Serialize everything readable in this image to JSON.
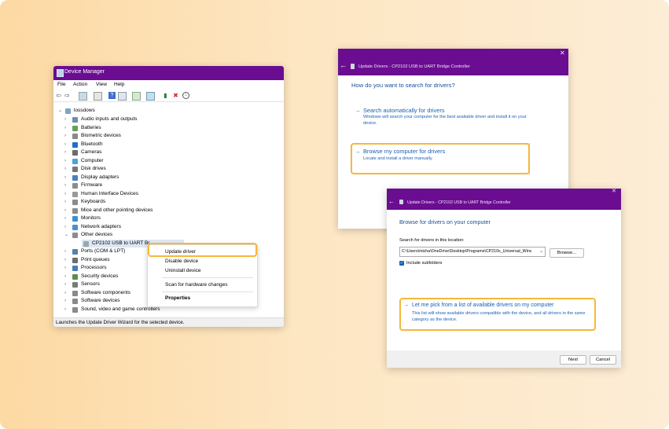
{
  "device_manager": {
    "title": "Device Manager",
    "menu": [
      "File",
      "Action",
      "View",
      "Help"
    ],
    "root": "lossdows",
    "categories": [
      "Audio inputs and outputs",
      "Batteries",
      "Biometric devices",
      "Bluetooth",
      "Cameras",
      "Computer",
      "Disk drives",
      "Display adapters",
      "Firmware",
      "Human Interface Devices",
      "Keyboards",
      "Mice and other pointing devices",
      "Monitors",
      "Network adapters",
      "Other devices"
    ],
    "selected_device": "CP2102 USB to UART Br",
    "categories_after": [
      "Ports (COM & LPT)",
      "Print queues",
      "Processors",
      "Security devices",
      "Sensors",
      "Software components",
      "Software devices",
      "Sound, video and game controllers"
    ],
    "status": "Launches the Update Driver Wizard for the selected device."
  },
  "context_menu": {
    "items": [
      "Update driver",
      "Disable device",
      "Uninstall device",
      "Scan for hardware changes",
      "Properties"
    ]
  },
  "wizard1": {
    "title": "Update Drivers - CP2102 USB to UART Bridge Controller",
    "question": "How do you want to search for drivers?",
    "option1_head": "Search automatically for drivers",
    "option1_desc": "Windows will search your computer for the best available driver and install it on your device.",
    "option2_head": "Browse my computer for drivers",
    "option2_desc": "Locate and install a driver manually."
  },
  "wizard2": {
    "title": "Update Drivers - CP2102 USB to UART Bridge Controller",
    "heading": "Browse for drivers on your computer",
    "search_label": "Search for drivers in this location:",
    "path": "C:\\Users\\micha\\OneDrive\\Desktop\\Programs\\CP210x_Universal_Winc",
    "browse": "Browse...",
    "include_subfolders": "Include subfolders",
    "pick_head": "Let me pick from a list of available drivers on my computer",
    "pick_desc": "This list will show available drivers compatible with the device, and all drivers in the same category as the device.",
    "next": "Next",
    "cancel": "Cancel"
  },
  "colors": {
    "titlebar": "#6a0d91",
    "highlight": "#f6b73c",
    "link": "#1a5fb4"
  }
}
